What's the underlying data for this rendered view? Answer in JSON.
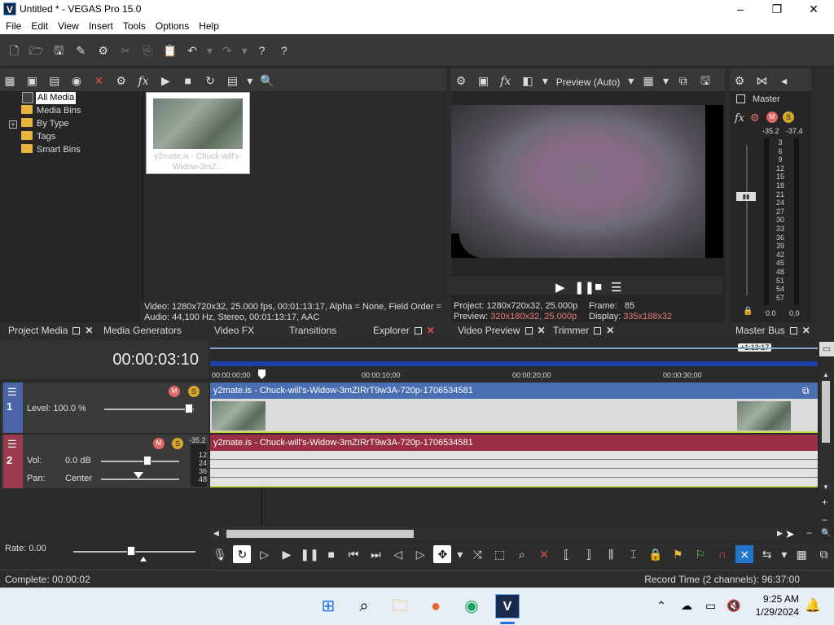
{
  "window": {
    "title": "Untitled * - VEGAS Pro 15.0",
    "app_icon": "V",
    "controls": [
      "–",
      "❐",
      "✕"
    ]
  },
  "menu": [
    "File",
    "Edit",
    "View",
    "Insert",
    "Tools",
    "Options",
    "Help"
  ],
  "project_media": {
    "tree": [
      "All Media",
      "Media Bins",
      "By Type",
      "Tags",
      "Smart Bins"
    ],
    "thumb_caption": "y2mate.is - Chuck-will's-Widow-3mZ...",
    "info_video": "Video: 1280x720x32, 25.000 fps, 00:01:13:17, Alpha = None, Field Order =",
    "info_audio": "Audio: 44,100 Hz, Stereo, 00:01:13:17, AAC"
  },
  "tabs_left": [
    "Project Media",
    "Media Generators",
    "Video FX",
    "Transitions",
    "Explorer"
  ],
  "preview": {
    "mode": "Preview (Auto)",
    "project_label": "Project:",
    "project_value": "1280x720x32, 25.000p",
    "frame_label": "Frame:",
    "frame_value": "85",
    "preview_label": "Preview:",
    "preview_value": "320x180x32, 25.000p",
    "display_label": "Display:",
    "display_value": "335x188x32"
  },
  "tabs_middle": [
    "Video Preview",
    "Trimmer"
  ],
  "master": {
    "label": "Master",
    "peak_left": "-35.2",
    "peak_right": "-37.4",
    "scale": [
      "3",
      "6",
      "9",
      "12",
      "15",
      "18",
      "21",
      "24",
      "27",
      "30",
      "33",
      "36",
      "39",
      "42",
      "45",
      "48",
      "51",
      "54",
      "57"
    ],
    "foot_left": "0.0",
    "foot_right": "0.0",
    "tab": "Master Bus"
  },
  "timeline": {
    "timecode": "00:00:03:10",
    "end_badge": "+1:13:17",
    "ruler": [
      "00:00:00;00",
      "00:00:10;00",
      "00:00:20;00",
      "00:00:30;00"
    ],
    "track1": {
      "number": "1",
      "level": "Level: 100.0 %",
      "clip": "y2mate.is - Chuck-will's-Widow-3mZIRrT9w3A-720p-1706534581"
    },
    "track2": {
      "number": "2",
      "vol_label": "Vol:",
      "vol_value": "0.0 dB",
      "pan_label": "Pan:",
      "pan_value": "Center",
      "peak": "-35.2",
      "meter": [
        "12",
        "24",
        "36",
        "48"
      ],
      "clip": "y2mate.is - Chuck-will's-Widow-3mZIRrT9w3A-720p-1706534581"
    },
    "rate": "Rate: 0.00"
  },
  "status": {
    "left": "Complete: 00:00:02",
    "right": "Record Time (2 channels): 96:37:00"
  },
  "taskbar": {
    "time": "9:25 AM",
    "date": "1/29/2024"
  }
}
